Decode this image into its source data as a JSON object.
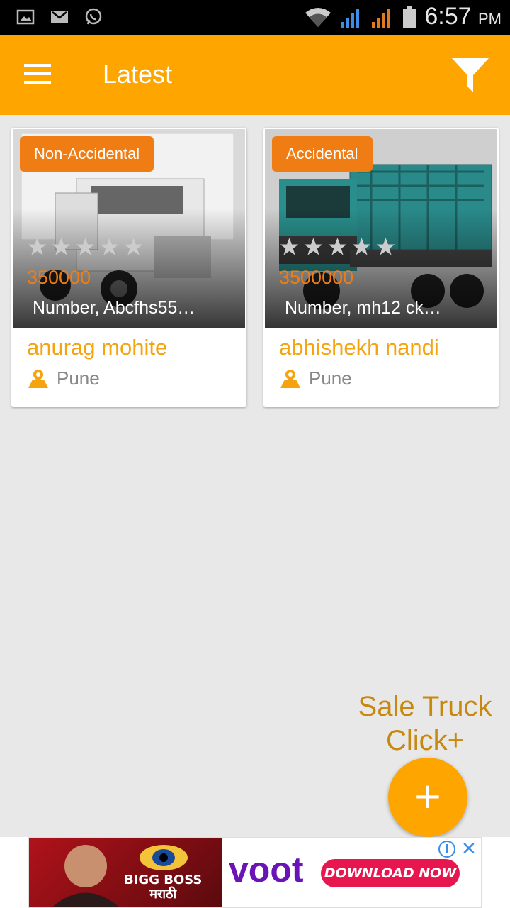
{
  "status_bar": {
    "time": "6:57",
    "ampm": "PM",
    "icons": [
      "gallery-icon",
      "gmail-icon",
      "whatsapp-icon",
      "wifi-icon",
      "signal-icon",
      "signal-icon-2",
      "battery-icon"
    ]
  },
  "app_bar": {
    "title": "Latest",
    "menu_icon": "hamburger-menu-icon",
    "filter_icon": "filter-icon"
  },
  "listings": [
    {
      "badge": "Non-Accidental",
      "rating": 0,
      "max_rating": 5,
      "price": "350000",
      "number": "Number, Abcfhs55…",
      "owner": "anurag mohite",
      "city": "Pune"
    },
    {
      "badge": "Accidental",
      "rating": 0,
      "max_rating": 5,
      "price": "3500000",
      "number": "Number, mh12 ck…",
      "owner": "abhishekh nandi",
      "city": "Pune"
    }
  ],
  "sale": {
    "line1": "Sale Truck",
    "line2": "Click+",
    "fab_label": "+"
  },
  "ad": {
    "brand": "BIGG BOSS",
    "brand_sub": "मराठी",
    "logo": "voot",
    "cta": "DOWNLOAD NOW",
    "info": "i",
    "close": "✕",
    "colors": {
      "voot": "#6a14b8",
      "cta": "#e8164e"
    }
  },
  "colors": {
    "accent": "#ffa500",
    "badge": "#f07d14",
    "owner": "#f5a30f",
    "sale_text": "#c8880e"
  }
}
